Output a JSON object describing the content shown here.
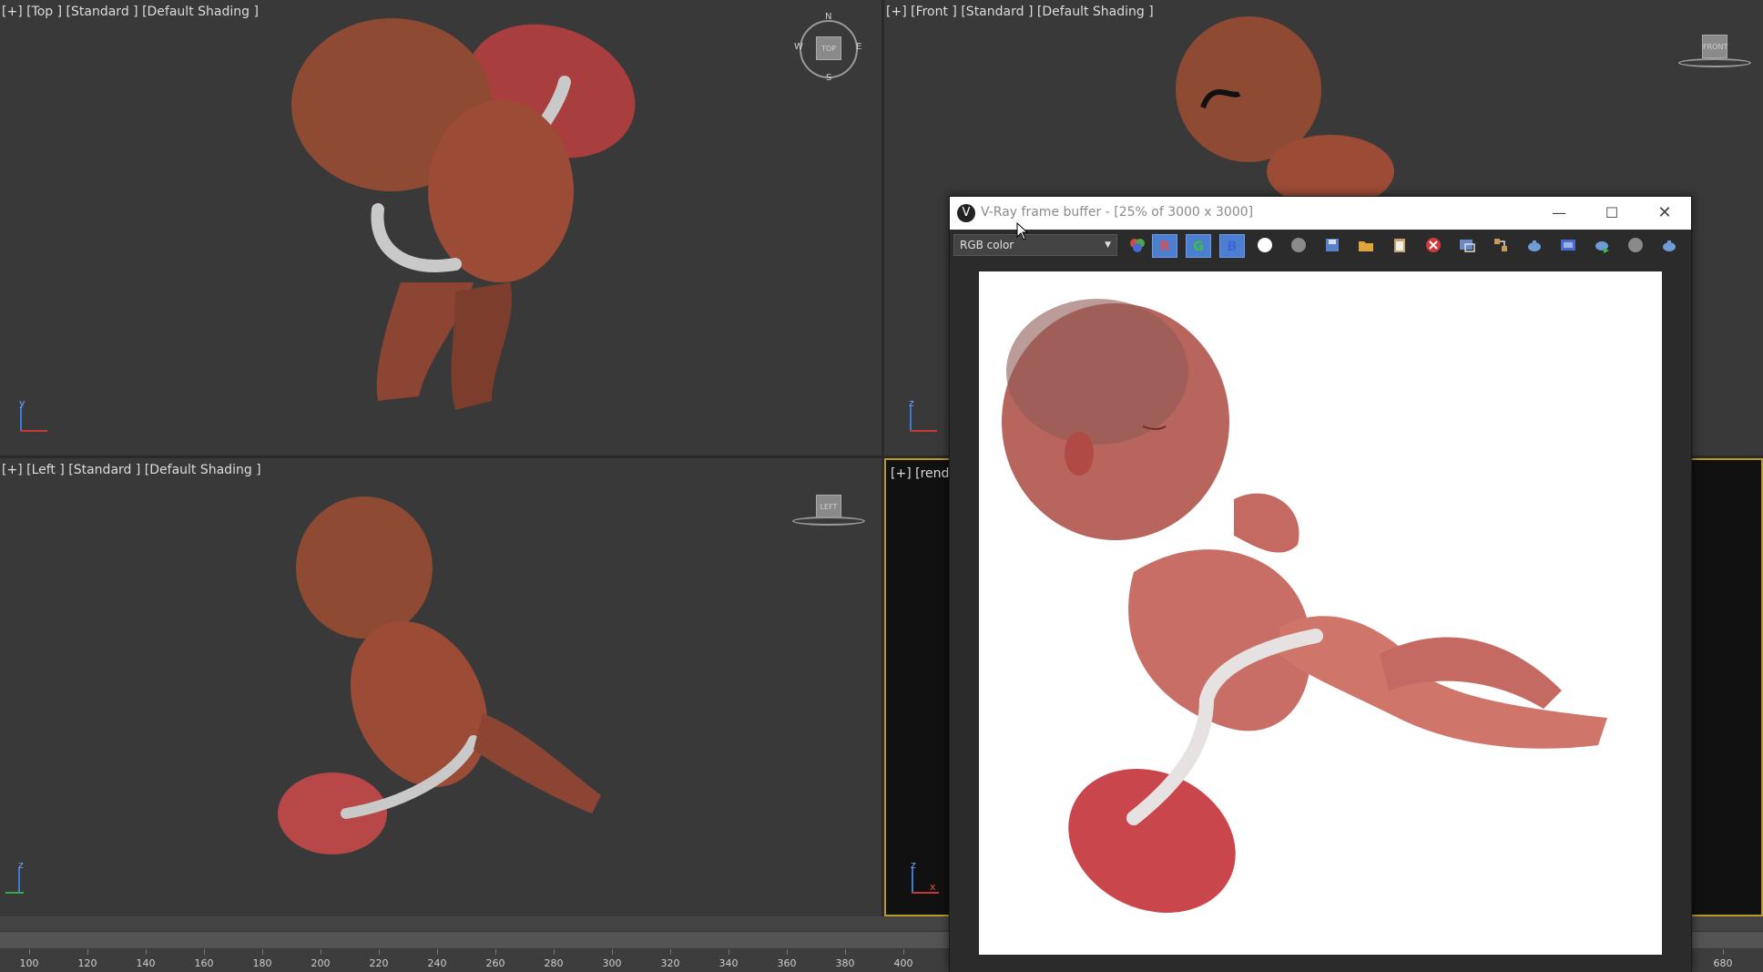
{
  "viewports": {
    "top": {
      "label": "[+] [Top ] [Standard ] [Default Shading ]",
      "viewcube_label": "TOP",
      "compass": {
        "n": "N",
        "s": "S",
        "e": "E",
        "w": "W"
      },
      "axis_up": "y"
    },
    "front": {
      "label": "[+] [Front ] [Standard ] [Default Shading ]",
      "viewcube_label": "FRONT",
      "axis_up": "z"
    },
    "left": {
      "label": "[+] [Left ] [Standard ] [Default Shading ]",
      "viewcube_label": "LEFT",
      "axis_up": "z"
    },
    "render": {
      "label": "[+] [rende",
      "axis_up": "z",
      "axis_right": "x"
    }
  },
  "frame_buffer": {
    "title": "V-Ray frame buffer - [25% of 3000 x 3000]",
    "channel": "RGB color",
    "channel_buttons": {
      "r": "R",
      "g": "G",
      "b": "B"
    },
    "toolbar_icons": [
      "color-balls-icon",
      "white-circle-icon",
      "gray-circle-icon",
      "save-icon",
      "open-folder-icon",
      "clipboard-icon",
      "clear-icon",
      "region-icon",
      "link-icon",
      "teapot-icon",
      "film-icon",
      "teapot-play-icon",
      "stop-icon",
      "teapot-icon-2"
    ]
  },
  "timeline": {
    "ticks": [
      "100",
      "120",
      "140",
      "160",
      "180",
      "200",
      "220",
      "240",
      "260",
      "280",
      "300",
      "320",
      "340",
      "360",
      "380",
      "400",
      "680"
    ]
  },
  "colors": {
    "viewport_bg": "#393939",
    "render_border": "#b89a2a",
    "channel_active": "#4d7fd0"
  }
}
